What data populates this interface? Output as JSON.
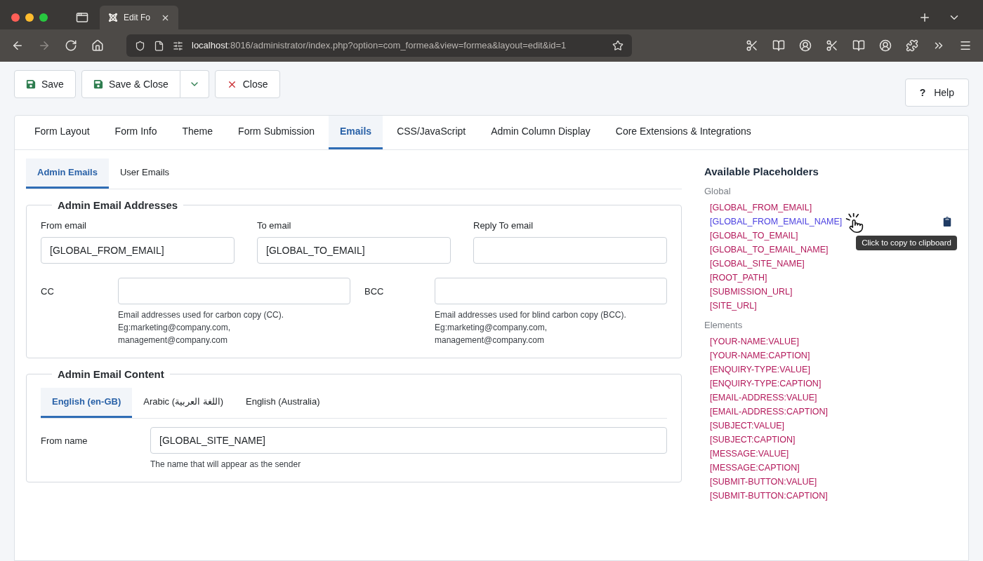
{
  "browser": {
    "tab": {
      "title": "Edit Fo"
    },
    "url": {
      "host": "localhost",
      "rest": ":8016/administrator/index.php?option=com_formea&view=formea&layout=edit&id=1"
    }
  },
  "toolbar": {
    "buttons": [
      {
        "label": "Save",
        "kind": "save"
      },
      {
        "label": "Save & Close",
        "kind": "save-menu"
      },
      {
        "label": "Close",
        "kind": "close"
      }
    ],
    "help": {
      "icon": "?",
      "label": "Help"
    }
  },
  "tabs": [
    {
      "label": "Form Layout",
      "selected": false
    },
    {
      "label": "Form Info",
      "selected": false
    },
    {
      "label": "Theme",
      "selected": false
    },
    {
      "label": "Form Submission",
      "selected": false
    },
    {
      "label": "Emails",
      "selected": true
    },
    {
      "label": "CSS/JavaScript",
      "selected": false
    },
    {
      "label": "Admin Column Display",
      "selected": false
    },
    {
      "label": "Core Extensions & Integrations",
      "selected": false
    }
  ],
  "subtabs": [
    {
      "label": "Admin Emails",
      "selected": true
    },
    {
      "label": "User Emails",
      "selected": false
    }
  ],
  "addresses": {
    "legend": "Admin Email Addresses",
    "fields": [
      {
        "label": "From email",
        "value": "[GLOBAL_FROM_EMAIL]"
      },
      {
        "label": "To email",
        "value": "[GLOBAL_TO_EMAIL]"
      },
      {
        "label": "Reply To email"
      }
    ],
    "copies": [
      {
        "label": "CC",
        "help": "Email addresses used for carbon copy (CC). Eg:marketing@company.com, management@company.com"
      },
      {
        "label": "BCC",
        "help": "Email addresses used for blind carbon copy (BCC). Eg:marketing@company.com, management@company.com"
      }
    ]
  },
  "content": {
    "legend": "Admin Email Content",
    "languages": [
      {
        "label": "English (en-GB)",
        "selected": true
      },
      {
        "label": "Arabic (اللغة العربية)",
        "selected": false
      },
      {
        "label": "English (Australia)",
        "selected": false
      }
    ],
    "from_name": {
      "label": "From name",
      "value": "[GLOBAL_SITE_NAME]",
      "help": "The name that will appear as the sender"
    }
  },
  "placeholders": {
    "title": "Available Placeholders",
    "tooltip": "Click to copy to clipboard",
    "groups": [
      {
        "label": "Global",
        "items": [
          {
            "text": "[GLOBAL_FROM_EMAIL]",
            "hovered": false
          },
          {
            "text": "[GLOBAL_FROM_EMAIL_NAME]",
            "hovered": true
          },
          {
            "text": "[GLOBAL_TO_EMAIL]",
            "hovered": false
          },
          {
            "text": "[GLOBAL_TO_EMAIL_NAME]",
            "hovered": false
          },
          {
            "text": "[GLOBAL_SITE_NAME]",
            "hovered": false
          },
          {
            "text": "[ROOT_PATH]",
            "hovered": false
          },
          {
            "text": "[SUBMISSION_URL]",
            "hovered": false
          },
          {
            "text": "[SITE_URL]",
            "hovered": false
          }
        ]
      },
      {
        "label": "Elements",
        "items": [
          {
            "text": "[YOUR-NAME:VALUE]",
            "hovered": false
          },
          {
            "text": "[YOUR-NAME:CAPTION]",
            "hovered": false
          },
          {
            "text": "[ENQUIRY-TYPE:VALUE]",
            "hovered": false
          },
          {
            "text": "[ENQUIRY-TYPE:CAPTION]",
            "hovered": false
          },
          {
            "text": "[EMAIL-ADDRESS:VALUE]",
            "hovered": false
          },
          {
            "text": "[EMAIL-ADDRESS:CAPTION]",
            "hovered": false
          },
          {
            "text": "[SUBJECT:VALUE]",
            "hovered": false
          },
          {
            "text": "[SUBJECT:CAPTION]",
            "hovered": false
          },
          {
            "text": "[MESSAGE:VALUE]",
            "hovered": false
          },
          {
            "text": "[MESSAGE:CAPTION]",
            "hovered": false
          },
          {
            "text": "[SUBMIT-BUTTON:VALUE]",
            "hovered": false
          },
          {
            "text": "[SUBMIT-BUTTON:CAPTION]",
            "hovered": false
          }
        ]
      }
    ]
  }
}
